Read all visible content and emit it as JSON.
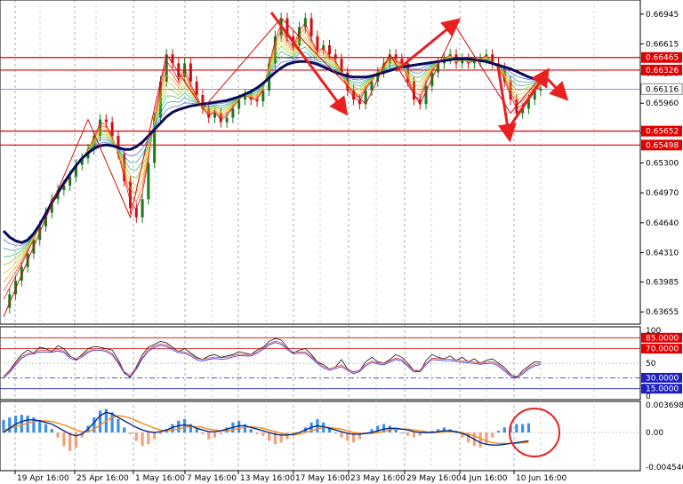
{
  "chart_data": {
    "type": "line",
    "price_panel": {
      "y_ticks": [
        0.66945,
        0.66615,
        0.6629,
        0.6596,
        0.6563,
        0.653,
        0.6497,
        0.6464,
        0.6431,
        0.63985,
        0.63655
      ],
      "ylim": [
        0.6352,
        0.671
      ],
      "levels": [
        {
          "label": "0.66465",
          "value": 0.66465,
          "kind": "resistance",
          "color": "#e00000"
        },
        {
          "label": "0.66326",
          "value": 0.66326,
          "kind": "resistance",
          "color": "#e00000"
        },
        {
          "label": "0.66116",
          "value": 0.66116,
          "kind": "current",
          "color": "#4a4af0"
        },
        {
          "label": "0.65652",
          "value": 0.65652,
          "kind": "support",
          "color": "#e00000"
        },
        {
          "label": "0.65498",
          "value": 0.65498,
          "kind": "support",
          "color": "#e00000"
        }
      ],
      "close": [
        0.637,
        0.6385,
        0.64,
        0.6415,
        0.643,
        0.6445,
        0.646,
        0.6475,
        0.649,
        0.65,
        0.6505,
        0.6515,
        0.6528,
        0.6535,
        0.6545,
        0.656,
        0.6578,
        0.6575,
        0.656,
        0.654,
        0.651,
        0.648,
        0.647,
        0.649,
        0.653,
        0.658,
        0.662,
        0.665,
        0.664,
        0.6625,
        0.664,
        0.662,
        0.6605,
        0.659,
        0.658,
        0.6585,
        0.6575,
        0.658,
        0.659,
        0.66,
        0.6605,
        0.66,
        0.6598,
        0.661,
        0.664,
        0.667,
        0.669,
        0.667,
        0.666,
        0.668,
        0.669,
        0.667,
        0.6655,
        0.666,
        0.665,
        0.6645,
        0.663,
        0.661,
        0.66,
        0.6595,
        0.661,
        0.662,
        0.663,
        0.664,
        0.665,
        0.6645,
        0.664,
        0.662,
        0.66,
        0.6595,
        0.6615,
        0.663,
        0.664,
        0.6645,
        0.665,
        0.664,
        0.6645,
        0.664,
        0.6642,
        0.6645,
        0.665,
        0.664,
        0.6635,
        0.662,
        0.66,
        0.6585,
        0.659,
        0.66,
        0.661,
        0.6612
      ],
      "ma_slow": [
        0.6455,
        0.6448,
        0.6444,
        0.6442,
        0.6445,
        0.6452,
        0.6462,
        0.6474,
        0.6486,
        0.6497,
        0.6508,
        0.6518,
        0.6527,
        0.6535,
        0.6541,
        0.6546,
        0.6549,
        0.655,
        0.6549,
        0.6547,
        0.6545,
        0.6545,
        0.6548,
        0.6553,
        0.656,
        0.6567,
        0.6574,
        0.6581,
        0.6586,
        0.6589,
        0.6591,
        0.6593,
        0.6594,
        0.6595,
        0.6596,
        0.6597,
        0.6598,
        0.6599,
        0.6601,
        0.6603,
        0.6606,
        0.6609,
        0.6613,
        0.6618,
        0.6624,
        0.663,
        0.6635,
        0.6639,
        0.6641,
        0.6642,
        0.6642,
        0.6641,
        0.6639,
        0.6636,
        0.6633,
        0.663,
        0.6628,
        0.6626,
        0.6625,
        0.6625,
        0.6625,
        0.6626,
        0.6628,
        0.663,
        0.6632,
        0.6634,
        0.6636,
        0.6637,
        0.6638,
        0.6639,
        0.664,
        0.6641,
        0.6642,
        0.6643,
        0.6644,
        0.6645,
        0.6645,
        0.6645,
        0.6644,
        0.6643,
        0.6642,
        0.664,
        0.6638,
        0.6636,
        0.6634,
        0.6631,
        0.6628,
        0.6625,
        0.6623,
        0.6622
      ]
    },
    "rsi_panel": {
      "y_ticks": [
        100,
        85.0,
        70.0,
        50,
        30.0,
        15.0,
        0
      ],
      "levels": [
        {
          "label": "85.0000",
          "value": 85,
          "color": "#e00000"
        },
        {
          "label": "70.0000",
          "value": 70,
          "color": "#e00000"
        },
        {
          "label": "30.0000",
          "value": 30,
          "color": "#2020c0"
        },
        {
          "label": "15.0000",
          "value": 15,
          "color": "#2020c0"
        }
      ],
      "values": [
        32,
        40,
        52,
        62,
        68,
        64,
        72,
        70,
        66,
        74,
        70,
        60,
        55,
        62,
        70,
        73,
        72,
        70,
        68,
        55,
        38,
        30,
        45,
        62,
        72,
        76,
        80,
        78,
        72,
        66,
        70,
        64,
        58,
        55,
        60,
        62,
        58,
        60,
        62,
        66,
        64,
        62,
        68,
        72,
        80,
        84,
        82,
        72,
        64,
        68,
        70,
        62,
        52,
        48,
        42,
        45,
        55,
        42,
        38,
        40,
        52,
        58,
        52,
        50,
        55,
        62,
        58,
        50,
        40,
        38,
        54,
        62,
        58,
        56,
        60,
        54,
        58,
        52,
        56,
        50,
        54,
        56,
        50,
        44,
        35,
        30,
        40,
        46,
        52,
        52
      ]
    },
    "macd_panel": {
      "y_ticks": [
        "0.0036986",
        "0.00",
        "-0.0045405"
      ],
      "ylim": [
        -0.0045405,
        0.0036986
      ],
      "histogram": [
        0.0015,
        0.0018,
        0.002,
        0.0021,
        0.002,
        0.0018,
        0.0015,
        0.001,
        0.0004,
        -0.0006,
        -0.0016,
        -0.0022,
        -0.0018,
        -0.0006,
        0.0008,
        0.0018,
        0.0026,
        0.0028,
        0.0024,
        0.0016,
        0.0006,
        -0.0002,
        -0.001,
        -0.0016,
        -0.0014,
        -0.0008,
        -0.0002,
        0.0004,
        0.001,
        0.0014,
        0.0016,
        0.001,
        0.0004,
        -0.0002,
        -0.0008,
        -0.0006,
        -0.0002,
        0.0006,
        0.0012,
        0.0014,
        0.001,
        0.0004,
        -0.0002,
        -0.0004,
        -0.001,
        -0.0014,
        -0.0012,
        -0.0008,
        -0.0004,
        0.0,
        0.0006,
        0.0012,
        0.0016,
        0.0012,
        0.0006,
        0.0,
        -0.0006,
        -0.001,
        -0.0012,
        -0.0008,
        -0.0002,
        0.0004,
        0.0008,
        0.001,
        0.0008,
        0.0004,
        0.0,
        -0.0004,
        -0.0006,
        -0.0004,
        0.0,
        0.0002,
        0.0004,
        0.0006,
        0.0004,
        0.0,
        -0.0006,
        -0.0012,
        -0.0016,
        -0.0018,
        -0.0014,
        -0.0006,
        0.0002,
        0.0006,
        0.0008,
        0.001,
        0.001,
        0.0011
      ],
      "macd": [
        0.0,
        0.0005,
        0.001,
        0.0013,
        0.0015,
        0.0015,
        0.0014,
        0.0012,
        0.001,
        0.0006,
        0.0002,
        -0.0002,
        -0.0004,
        -0.0002,
        0.0004,
        0.0012,
        0.002,
        0.0024,
        0.0022,
        0.0018,
        0.0014,
        0.001,
        0.0006,
        0.0003,
        0.0001,
        0.0,
        0.0001,
        0.0003,
        0.0006,
        0.0008,
        0.0009,
        0.0008,
        0.0005,
        0.0003,
        0.0001,
        0.0001,
        0.0002,
        0.0004,
        0.0006,
        0.0008,
        0.0008,
        0.0006,
        0.0004,
        0.0002,
        0.0,
        -0.0002,
        -0.0003,
        -0.0003,
        -0.0002,
        0.0,
        0.0003,
        0.0006,
        0.0008,
        0.0007,
        0.0005,
        0.0003,
        0.0001,
        -0.0001,
        -0.0002,
        -0.0002,
        -0.0001,
        0.0,
        0.0002,
        0.0004,
        0.0005,
        0.0005,
        0.0004,
        0.0003,
        0.0001,
        0.0,
        0.0,
        0.0,
        0.0001,
        0.0002,
        0.0002,
        0.0001,
        -0.0001,
        -0.0004,
        -0.0008,
        -0.0012,
        -0.0014,
        -0.0015,
        -0.0015,
        -0.0014,
        -0.0013,
        -0.0012,
        -0.0011,
        -0.001
      ],
      "signal": [
        0.0003,
        0.0005,
        0.0007,
        0.0009,
        0.0011,
        0.0013,
        0.0014,
        0.0014,
        0.0013,
        0.0011,
        0.0009,
        0.0006,
        0.0003,
        0.0001,
        0.0001,
        0.0004,
        0.0009,
        0.0014,
        0.0018,
        0.002,
        0.0019,
        0.0017,
        0.0014,
        0.0011,
        0.0008,
        0.0005,
        0.0003,
        0.0002,
        0.0003,
        0.0004,
        0.0006,
        0.0007,
        0.0007,
        0.0006,
        0.0004,
        0.0003,
        0.0002,
        0.0002,
        0.0003,
        0.0005,
        0.0006,
        0.0007,
        0.0006,
        0.0005,
        0.0003,
        0.0001,
        -0.0001,
        -0.0002,
        -0.0003,
        -0.0002,
        0.0,
        0.0002,
        0.0004,
        0.0006,
        0.0006,
        0.0005,
        0.0004,
        0.0002,
        0.0,
        -0.0001,
        -0.0001,
        -0.0001,
        0.0,
        0.0001,
        0.0003,
        0.0004,
        0.0004,
        0.0004,
        0.0003,
        0.0002,
        0.0001,
        0.0,
        0.0,
        0.0001,
        0.0001,
        0.0001,
        0.0,
        -0.0002,
        -0.0004,
        -0.0007,
        -0.001,
        -0.0012,
        -0.0013,
        -0.0013,
        -0.0013,
        -0.0013,
        -0.0012,
        -0.0012
      ]
    },
    "x_labels": [
      "19 Apr 16:00",
      "25 Apr 16:00",
      "1 May 16:00",
      "7 May 16:00",
      "13 May 16:00",
      "17 May 16:00",
      "23 May 16:00",
      "29 May 16:00",
      "4 Jun 16:00",
      "10 Jun 16:00"
    ],
    "grid": true,
    "colors": {
      "bull_candle": "#1a7a1a",
      "bear_candle": "#d01010",
      "ma_slow": "#0a0a5a",
      "level_red": "#e00000",
      "rsi_main": "#111111",
      "rsi_blue": "#2a2adf",
      "rsi_red": "#e04040",
      "macd_pos": "#3a8fe8",
      "macd_neg": "#f4a07a",
      "macd_line": "#0a2a8a",
      "signal_line": "#f08c1a",
      "arrow": "#e82020",
      "circle": "#e82020"
    },
    "annotations": {
      "arrows": 5,
      "circle": "around latest MACD bars"
    }
  }
}
